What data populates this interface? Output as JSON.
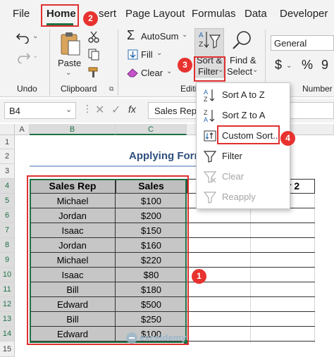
{
  "menu": {
    "tabs": [
      "File",
      "Home",
      "Insert",
      "Page Layout",
      "Formulas",
      "Data",
      "Developer"
    ],
    "insert_visible": "sert"
  },
  "ribbon": {
    "autosum": "AutoSum",
    "fill": "Fill",
    "clear": "Clear",
    "sort_filter_line1": "Sort &",
    "sort_filter_line2": "Filter",
    "find_select_line1": "Find &",
    "find_select_line2": "Select",
    "number_format": "General",
    "paste": "Paste",
    "groups": {
      "undo": "Undo",
      "clipboard": "Clipboard",
      "editing": "Editi",
      "number": "Number"
    },
    "currency_symbol": "$",
    "percent_symbol": "%"
  },
  "formula_bar": {
    "name_box": "B4",
    "formula_text": "Sales Rep",
    "fx": "fx"
  },
  "sheet": {
    "columns": [
      "A",
      "B",
      "C"
    ],
    "rows": [
      "1",
      "2",
      "3",
      "4",
      "5",
      "6",
      "7",
      "8",
      "9",
      "10",
      "11",
      "12",
      "13",
      "14",
      "15"
    ],
    "title": "Applying Form",
    "header_sales_rep": "Sales Rep",
    "header_sales": "Sales",
    "header_partial": "r 2",
    "data": [
      {
        "rep": "Michael",
        "sales": "$100"
      },
      {
        "rep": "Jordan",
        "sales": "$200"
      },
      {
        "rep": "Isaac",
        "sales": "$150"
      },
      {
        "rep": "Jordan",
        "sales": "$160"
      },
      {
        "rep": "Michael",
        "sales": "$220"
      },
      {
        "rep": "Isaac",
        "sales": "$80"
      },
      {
        "rep": "Bill",
        "sales": "$180"
      },
      {
        "rep": "Edward",
        "sales": "$500"
      },
      {
        "rep": "Bill",
        "sales": "$250"
      },
      {
        "rep": "Edward",
        "sales": "$100"
      }
    ]
  },
  "dropdown": {
    "items": [
      {
        "label": "Sort A to Z",
        "enabled": true
      },
      {
        "label": "Sort Z to A",
        "enabled": true
      },
      {
        "label": "Custom Sort...",
        "enabled": true
      },
      {
        "label": "Filter",
        "enabled": true
      },
      {
        "label": "Clear",
        "enabled": false
      },
      {
        "label": "Reapply",
        "enabled": false
      }
    ]
  },
  "badges": [
    "1",
    "2",
    "3",
    "4"
  ],
  "watermark": "exceldemy",
  "colors": {
    "accent_red": "#e03030",
    "excel_green": "#1e7145",
    "header_fill": "#bfbfbf",
    "selection_fill": "#c6c6c6",
    "title_blue": "#2f4f7f"
  }
}
